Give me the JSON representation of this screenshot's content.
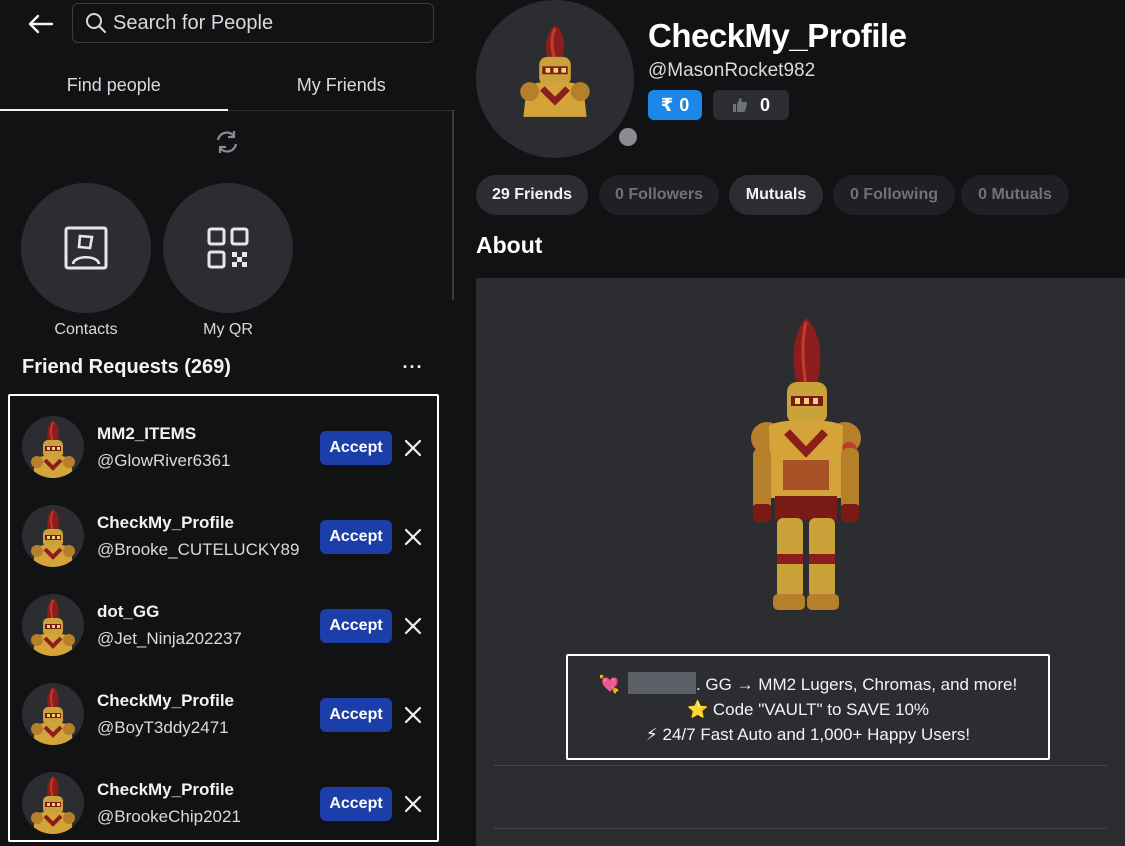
{
  "search": {
    "placeholder": "Search for People"
  },
  "tabs": [
    {
      "label": "Find people",
      "active": true
    },
    {
      "label": "My Friends",
      "active": false
    }
  ],
  "quick_actions": [
    {
      "label": "Contacts",
      "icon": "contact-card-icon"
    },
    {
      "label": "My QR",
      "icon": "qr-code-icon"
    }
  ],
  "requests": {
    "title": "Friend Requests (269)",
    "more_label": "···",
    "accept_label": "Accept",
    "items": [
      {
        "name": "MM2_ITEMS",
        "handle": "@GlowRiver6361"
      },
      {
        "name": "CheckMy_Profile",
        "handle": "@Brooke_CUTELUCKY89"
      },
      {
        "name": "dot_GG",
        "handle": "@Jet_Ninja202237"
      },
      {
        "name": "CheckMy_Profile",
        "handle": "@BoyT3ddy2471"
      },
      {
        "name": "CheckMy_Profile",
        "handle": "@BrookeChip2021"
      }
    ]
  },
  "profile": {
    "display_name": "CheckMy_Profile",
    "username": "@MasonRocket982",
    "robux_count": "0",
    "likes_count": "0",
    "status": "offline",
    "chips": [
      {
        "label": "29 Friends",
        "active": true
      },
      {
        "label": "0 Followers",
        "active": false
      },
      {
        "label": "Mutuals",
        "active": true
      },
      {
        "label": "0 Following",
        "active": false
      },
      {
        "label": "0 Mutuals",
        "active": false
      }
    ],
    "about_title": "About",
    "bio": {
      "line1_prefix": "💘",
      "line1_text": ". GG → MM2 Lugers, Chromas, and more!",
      "line2": "⭐ Code \"VAULT\" to SAVE 10%",
      "line3": "⚡ 24/7 Fast Auto and 1,000+ Happy Users!"
    }
  },
  "colors": {
    "background": "#111214",
    "panel": "#2b2d31",
    "accept_button": "#1c3ea8",
    "robux_badge": "#1b87e6",
    "highlight_border": "#ffffff"
  }
}
